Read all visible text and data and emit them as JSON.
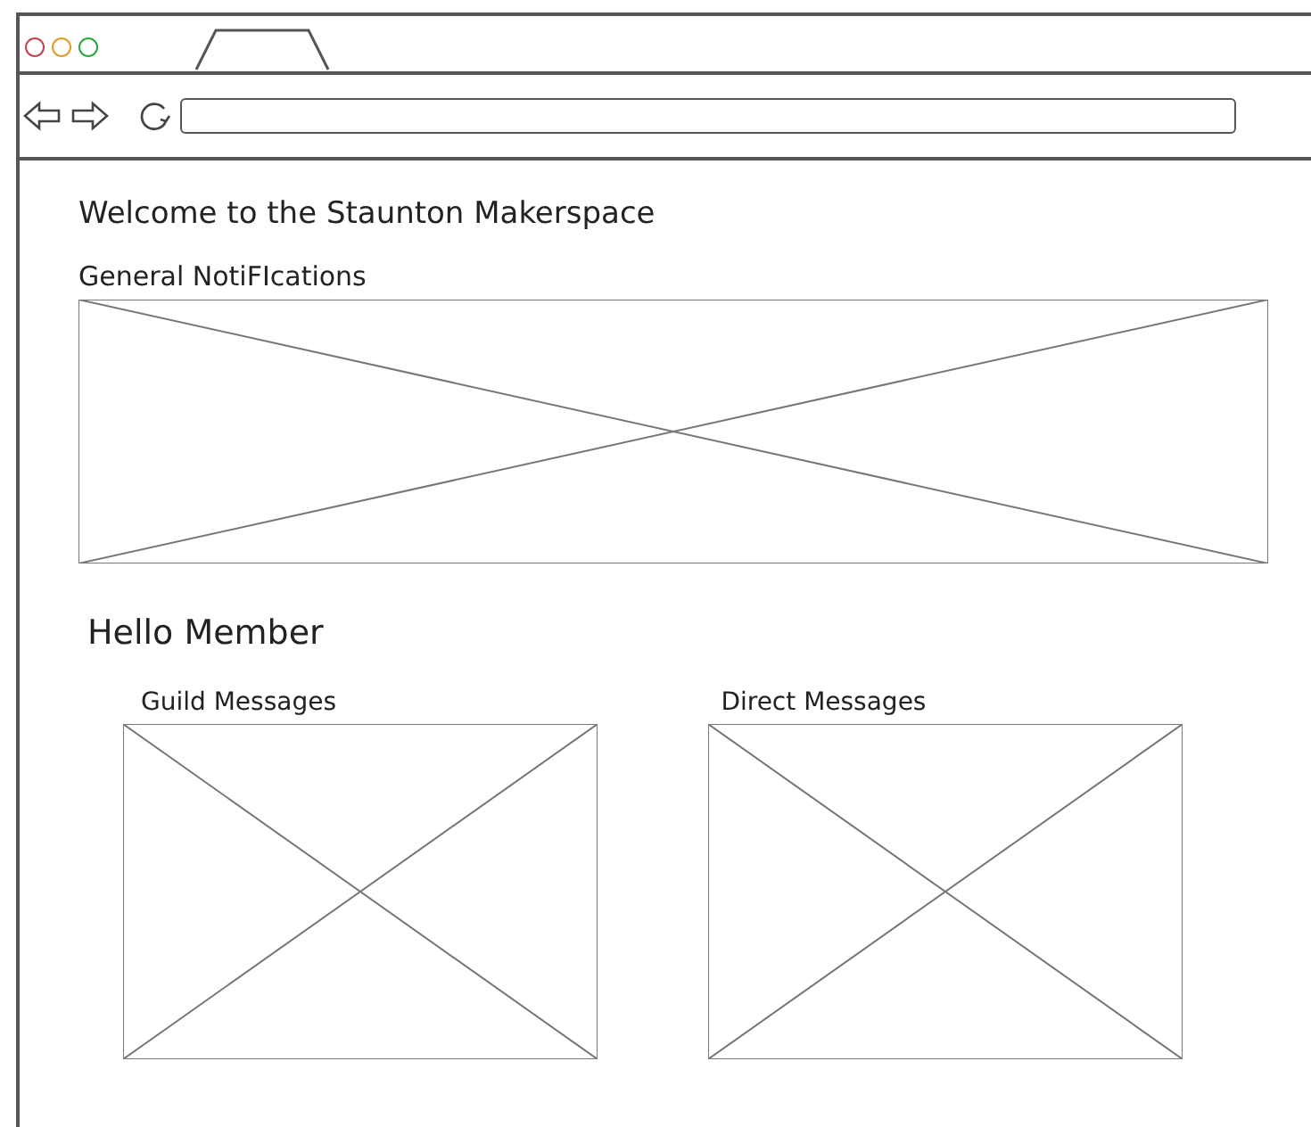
{
  "heading": "Welcome to the Staunton Makerspace",
  "notifications": {
    "title": "General NotiFIcations"
  },
  "greeting": "Hello Member",
  "panels": [
    {
      "title": "Guild Messages"
    },
    {
      "title": "Direct Messages"
    }
  ]
}
